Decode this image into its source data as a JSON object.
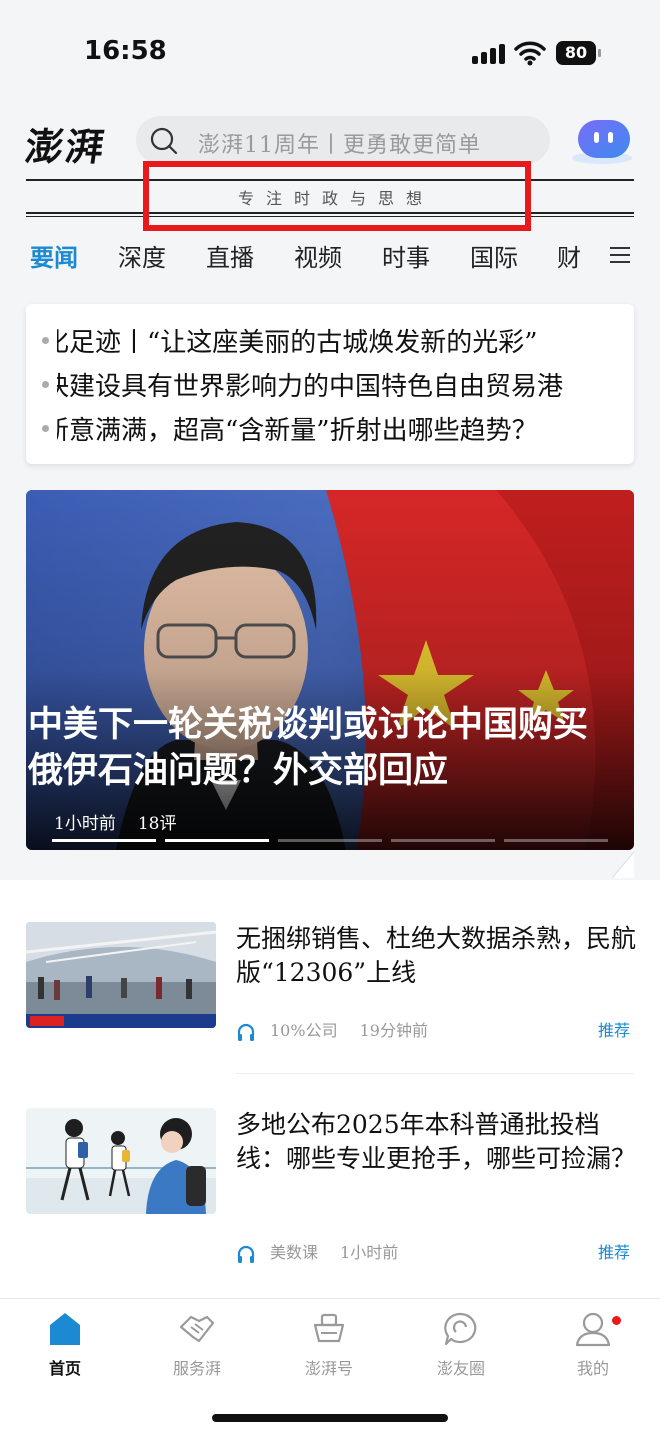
{
  "status_bar": {
    "time": "16:58",
    "battery": "80"
  },
  "header": {
    "logo": "澎湃",
    "search_placeholder": "澎湃11周年丨更勇敢更简单",
    "slogan": "专注时政与思想"
  },
  "tabs": [
    {
      "label": "要闻",
      "active": true
    },
    {
      "label": "深度"
    },
    {
      "label": "直播"
    },
    {
      "label": "视频"
    },
    {
      "label": "时事"
    },
    {
      "label": "国际"
    },
    {
      "label": "财"
    }
  ],
  "headlines": [
    "化足迹丨“让这座美丽的古城焕发新的光彩”",
    "快建设具有世界影响力的中国特色自由贸易港",
    "新意满满，超高“含新量”折射出哪些趋势？"
  ],
  "featured": {
    "title": "中美下一轮关税谈判或讨论中国购买俄伊石油问题？外交部回应",
    "time": "1小时前",
    "comments": "18评",
    "slides_total": 5,
    "slide_active": 2
  },
  "news": [
    {
      "title": "无捆绑销售、杜绝大数据杀熟，民航版“12306”上线",
      "source": "10%公司",
      "time": "19分钟前",
      "tag": "推荐"
    },
    {
      "title": "多地公布2025年本科普通批投档线：哪些专业更抢手，哪些可捡漏？",
      "source": "美数课",
      "time": "1小时前",
      "tag": "推荐"
    }
  ],
  "bottom_nav": [
    {
      "label": "首页",
      "icon": "home-icon",
      "active": true
    },
    {
      "label": "服务湃",
      "icon": "handshake-icon"
    },
    {
      "label": "澎湃号",
      "icon": "ship-icon"
    },
    {
      "label": "澎友圈",
      "icon": "chat-icon"
    },
    {
      "label": "我的",
      "icon": "profile-icon"
    }
  ],
  "colors": {
    "accent": "#1c8ad2",
    "highlight": "#e8191c"
  }
}
